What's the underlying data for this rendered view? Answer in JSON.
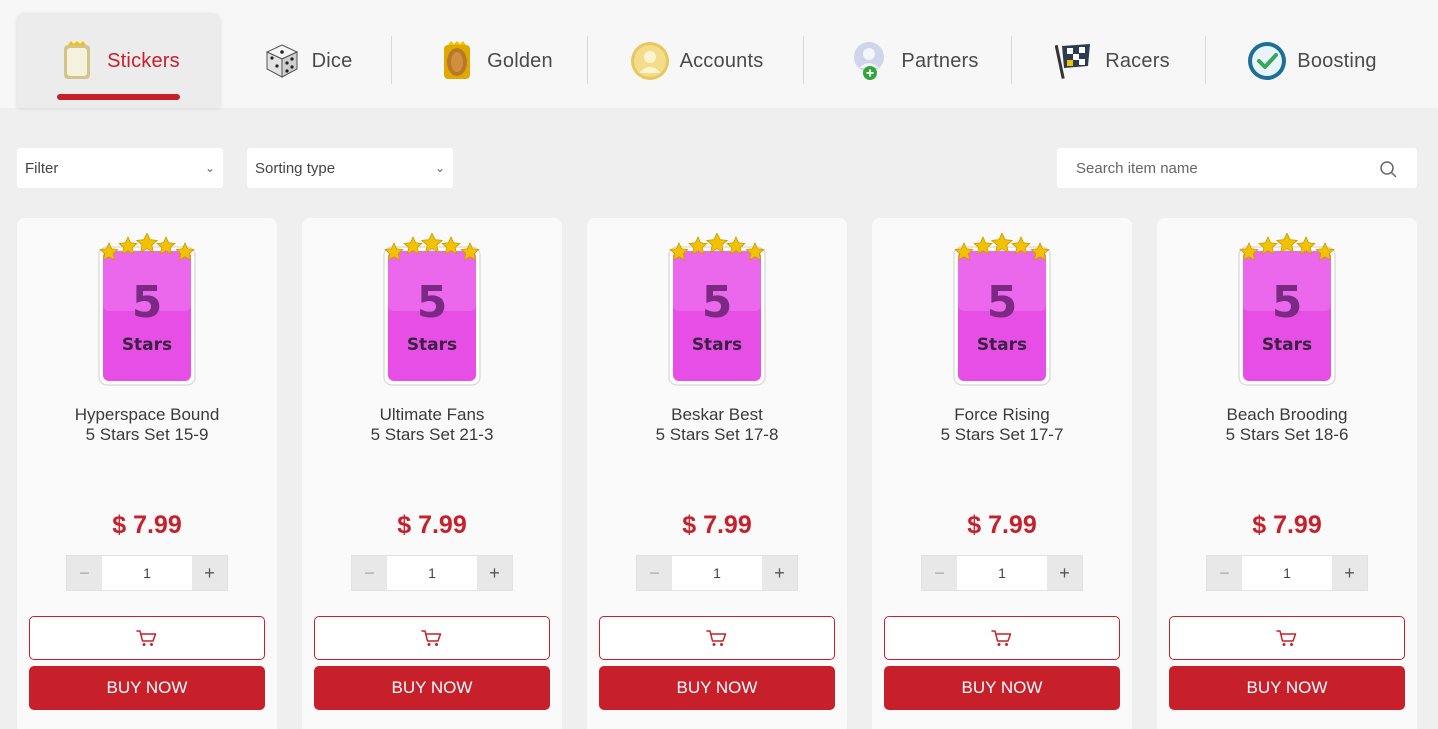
{
  "tabs": [
    {
      "label": "Stickers",
      "icon": "sticker-icon",
      "active": true
    },
    {
      "label": "Dice",
      "icon": "dice-icon",
      "active": false
    },
    {
      "label": "Golden",
      "icon": "golden-card-icon",
      "active": false
    },
    {
      "label": "Accounts",
      "icon": "account-icon",
      "active": false
    },
    {
      "label": "Partners",
      "icon": "partner-add-icon",
      "active": false
    },
    {
      "label": "Racers",
      "icon": "racing-flag-icon",
      "active": false
    },
    {
      "label": "Boosting",
      "icon": "check-circle-icon",
      "active": false
    }
  ],
  "filters": {
    "filter_label": "Filter",
    "sort_label": "Sorting type",
    "search_placeholder": "Search item name"
  },
  "colors": {
    "accent": "#c8202a",
    "card_pink": "#e64ee6",
    "star_gold": "#f2c200"
  },
  "sticker_badge": {
    "number": "5",
    "word": "Stars"
  },
  "products": [
    {
      "name_line1": "Hyperspace Bound",
      "name_line2": "5 Stars Set 15-9",
      "price": "$ 7.99",
      "qty": "1"
    },
    {
      "name_line1": "Ultimate Fans",
      "name_line2": "5 Stars Set 21-3",
      "price": "$ 7.99",
      "qty": "1"
    },
    {
      "name_line1": "Beskar Best",
      "name_line2": "5 Stars Set 17-8",
      "price": "$ 7.99",
      "qty": "1"
    },
    {
      "name_line1": "Force Rising",
      "name_line2": "5 Stars Set 17-7",
      "price": "$ 7.99",
      "qty": "1"
    },
    {
      "name_line1": "Beach Brooding",
      "name_line2": "5 Stars Set 18-6",
      "price": "$ 7.99",
      "qty": "1"
    }
  ],
  "qty_minus": "−",
  "qty_plus": "+",
  "buy_label": "BUY NOW"
}
